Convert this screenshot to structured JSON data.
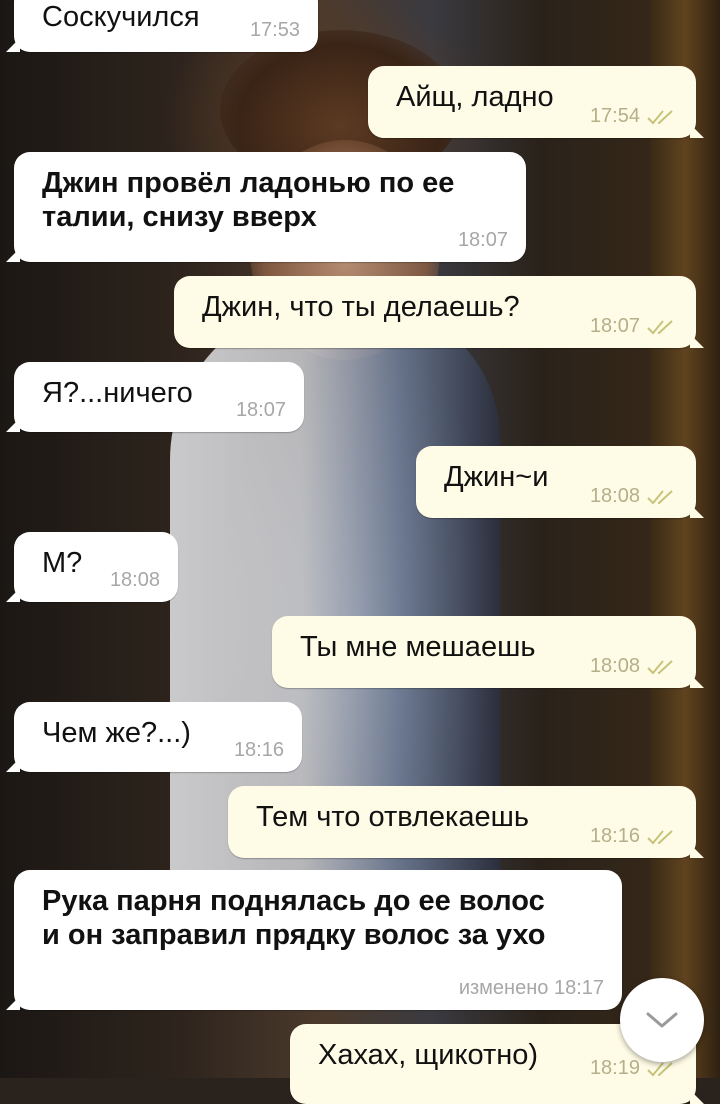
{
  "messages": [
    {
      "direction": "in",
      "text": "Соскучился",
      "time": "17:53",
      "bold": false
    },
    {
      "direction": "out",
      "text": "Айщ, ладно",
      "time": "17:54",
      "read": true
    },
    {
      "direction": "in",
      "text": "Джин провёл ладонью по ее\nталии, снизу вверх",
      "time": "18:07",
      "bold": true
    },
    {
      "direction": "out",
      "text": "Джин, что ты делаешь?",
      "time": "18:07",
      "read": true
    },
    {
      "direction": "in",
      "text": "Я?...ничего",
      "time": "18:07",
      "bold": false
    },
    {
      "direction": "out",
      "text": "Джин~и",
      "time": "18:08",
      "read": true
    },
    {
      "direction": "in",
      "text": "М?",
      "time": "18:08",
      "bold": false
    },
    {
      "direction": "out",
      "text": "Ты мне мешаешь",
      "time": "18:08",
      "read": true
    },
    {
      "direction": "in",
      "text": "Чем же?...)",
      "time": "18:16",
      "bold": false
    },
    {
      "direction": "out",
      "text": "Тем что отвлекаешь",
      "time": "18:16",
      "read": true
    },
    {
      "direction": "in",
      "text": "Рука парня поднялась до ее волос\nи он заправил прядку волос за ухо",
      "time": "изменено 18:17",
      "bold": true
    },
    {
      "direction": "out",
      "text": "Хахах, щикотно)",
      "time": "18:19",
      "read": true
    }
  ],
  "scroll_button_icon": "chevron-down-icon",
  "colors": {
    "incoming_bubble": "#ffffff",
    "outgoing_bubble": "#fefbe6",
    "read_check": "#c6c37a"
  }
}
